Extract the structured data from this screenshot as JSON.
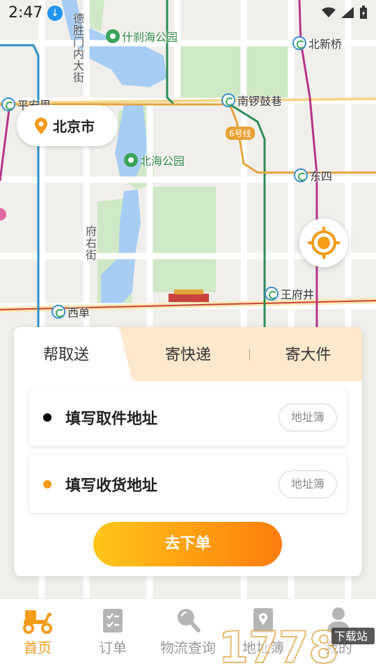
{
  "status_bar": {
    "time": "2:47"
  },
  "map": {
    "labels": {
      "deshengmen": "德胜门内大街",
      "shichahai": "什刹海公园",
      "beixinqiao": "北新桥",
      "pinganli": "平安里",
      "nanluoguxiang": "南锣鼓巷",
      "line6": "6号线",
      "beihai": "北海公园",
      "dongsi": "东四",
      "fuyoujie": "府右街",
      "wangfujing": "王府井",
      "xidan": "西单"
    }
  },
  "city": {
    "name": "北京市"
  },
  "order_card": {
    "tabs": [
      "帮取送",
      "寄快递",
      "寄大件"
    ],
    "pickup": {
      "placeholder": "填写取件地址",
      "book": "地址簿"
    },
    "delivery": {
      "placeholder": "填写收货地址",
      "book": "地址簿"
    },
    "submit_label": "去下单"
  },
  "bottom_nav": {
    "items": [
      {
        "label": "首页",
        "icon": "scooter-icon",
        "active": true
      },
      {
        "label": "订单",
        "icon": "clipboard-icon",
        "active": false
      },
      {
        "label": "物流查询",
        "icon": "search-icon",
        "active": false
      },
      {
        "label": "地址簿",
        "icon": "location-book-icon",
        "active": false
      },
      {
        "label": "我的",
        "icon": "person-icon",
        "active": false
      }
    ]
  },
  "watermark": {
    "text": "1778",
    "badge": "下载站"
  },
  "colors": {
    "accent": "#f49b19",
    "tab_bg": "#fde8cc",
    "pickup_dot": "#000000",
    "delivery_dot": "#f49b19"
  }
}
